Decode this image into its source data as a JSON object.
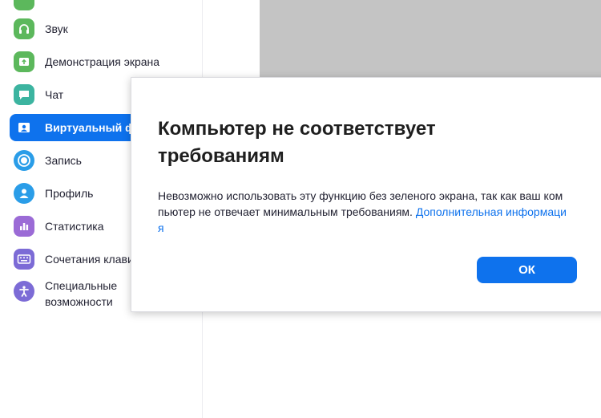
{
  "sidebar": {
    "items": [
      {
        "label": "",
        "icon": "video-icon",
        "color": "#5cb85c"
      },
      {
        "label": "Звук",
        "icon": "headphones-icon",
        "color": "#5cb85c"
      },
      {
        "label": "Демонстрация экрана",
        "icon": "screen-share-icon",
        "color": "#5cb85c"
      },
      {
        "label": "Чат",
        "icon": "chat-icon",
        "color": "#3cb4a0"
      },
      {
        "label": "Виртуальный ф",
        "icon": "virtual-background-icon",
        "color": "#0e72ed",
        "active": true
      },
      {
        "label": "Запись",
        "icon": "record-icon",
        "color": "#2a9de8"
      },
      {
        "label": "Профиль",
        "icon": "profile-icon",
        "color": "#2a9de8"
      },
      {
        "label": "Статистика",
        "icon": "statistics-icon",
        "color": "#9b6bd6"
      },
      {
        "label": "Сочетания клави",
        "icon": "keyboard-icon",
        "color": "#7c6bd6"
      },
      {
        "label": "Специальные возможности",
        "icon": "accessibility-icon",
        "color": "#7c6bd6"
      }
    ]
  },
  "dialog": {
    "title": "Компьютер не соответствует требованиям",
    "body": "Невозможно использовать эту функцию без зеленого экрана, так как ваш компьютер не отвечает минимальным требованиям. ",
    "link": "Дополнительная информация",
    "ok_label": "ОК"
  }
}
